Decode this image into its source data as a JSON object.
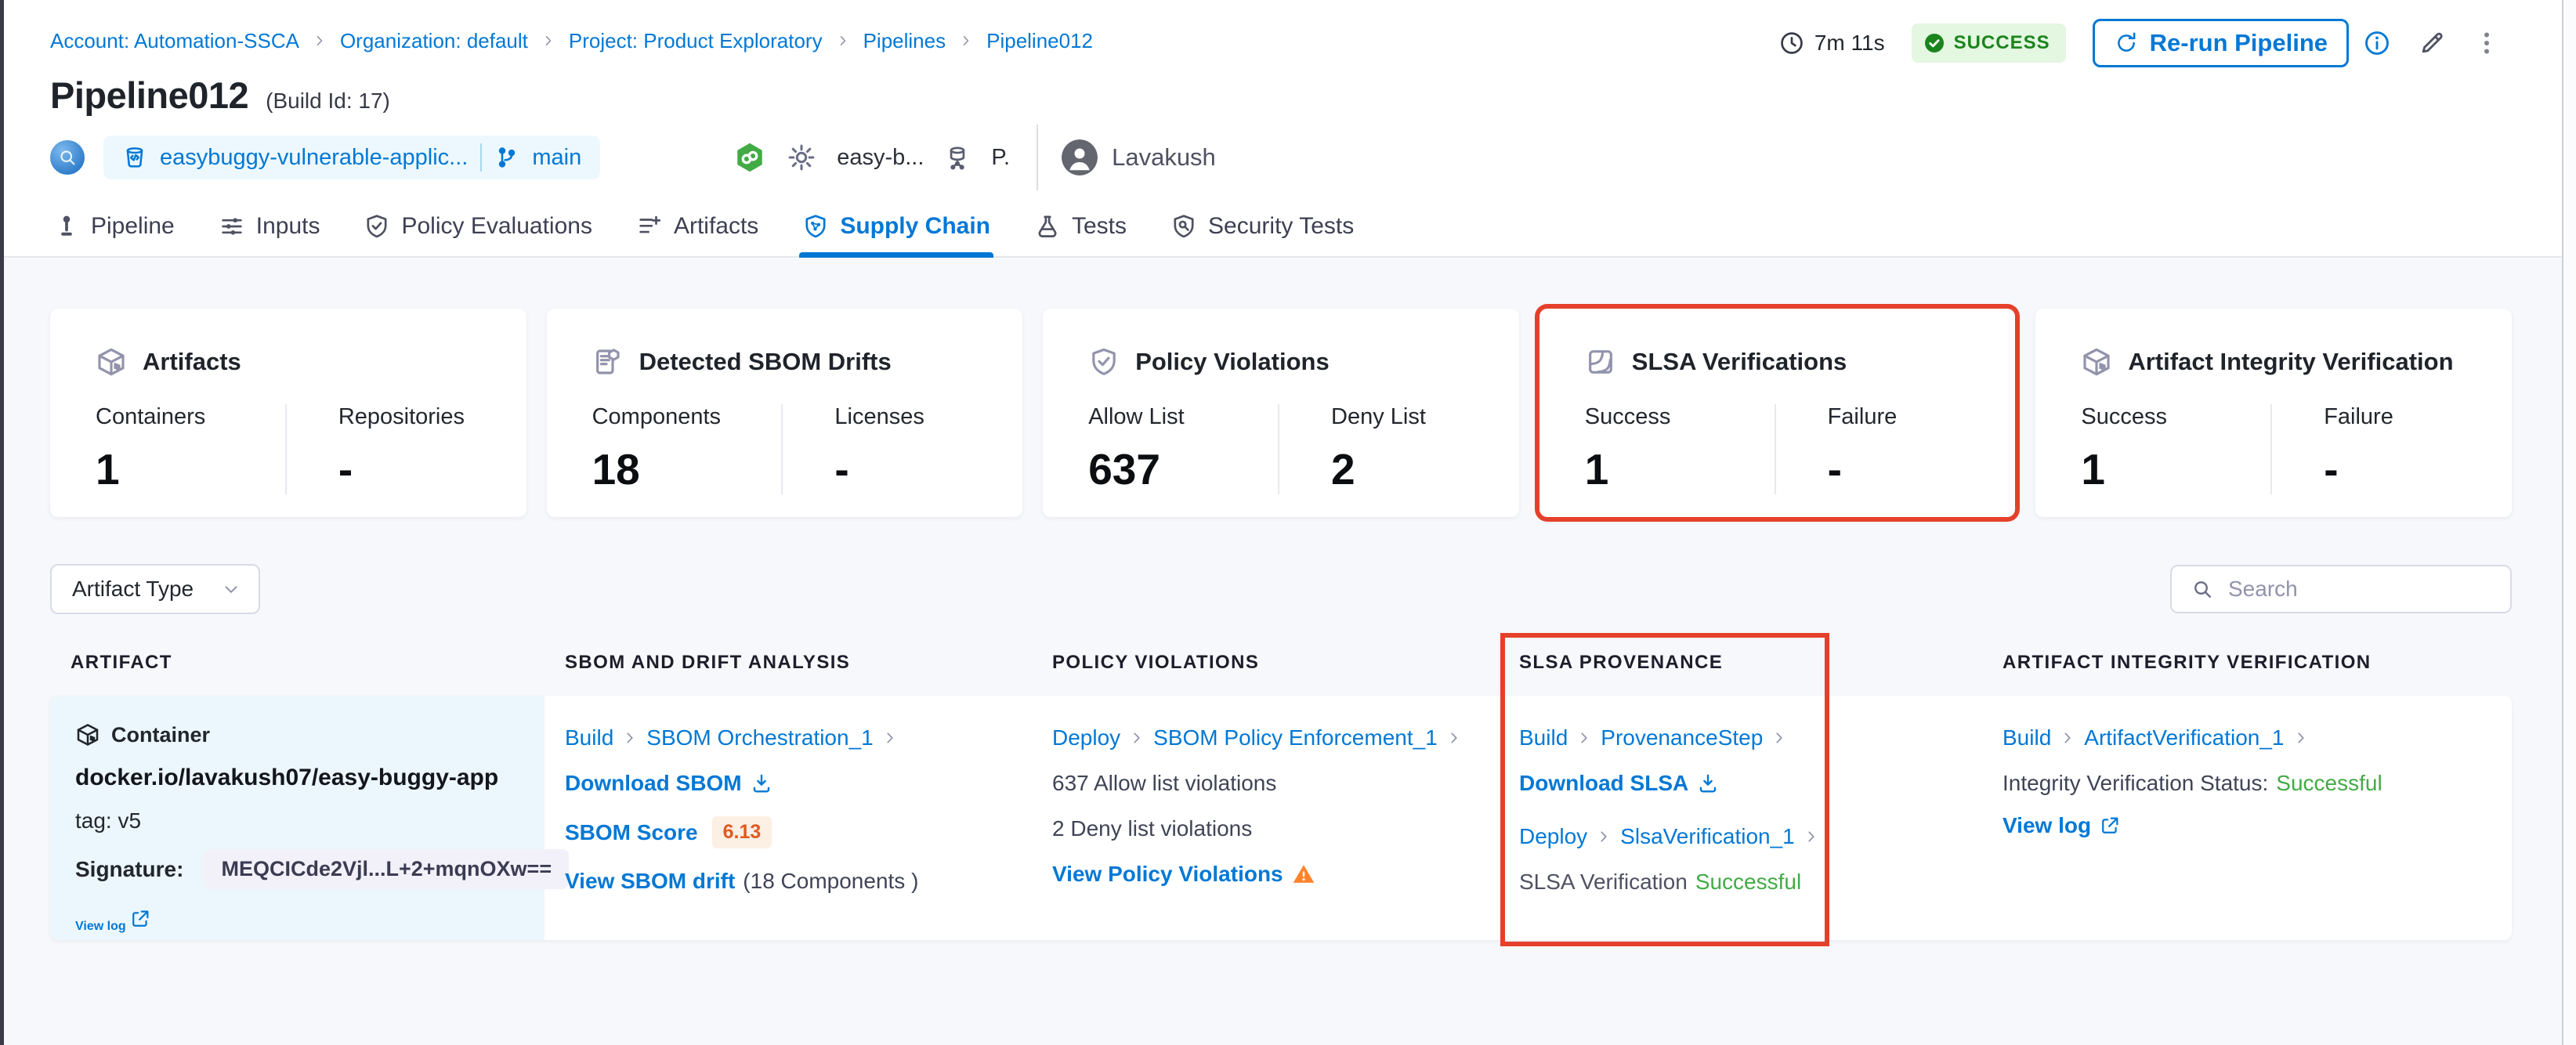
{
  "colors": {
    "primary_blue": "#0278d5",
    "success_green": "#1b841d",
    "success_text_green": "#42ab45",
    "annotation_red": "#e5402a",
    "warning_orange": "#ff832b",
    "score_orange": "#e05a1f",
    "page_background": "#f7f8fb"
  },
  "breadcrumb": {
    "items": [
      "Account: Automation-SSCA",
      "Organization: default",
      "Project: Product Exploratory",
      "Pipelines",
      "Pipeline012"
    ]
  },
  "header": {
    "title": "Pipeline012",
    "build_id": "(Build Id: 17)",
    "duration": "7m 11s",
    "status": "SUCCESS",
    "rerun_label": "Re-run Pipeline",
    "repo_name": "easybuggy-vulnerable-applic...",
    "branch": "main",
    "trigger_text": "easy-b...",
    "trigger_initial": "P.",
    "user_name": "Lavakush"
  },
  "tabs": [
    {
      "id": "pipeline",
      "label": "Pipeline",
      "active": false
    },
    {
      "id": "inputs",
      "label": "Inputs",
      "active": false
    },
    {
      "id": "policy-evaluations",
      "label": "Policy Evaluations",
      "active": false
    },
    {
      "id": "artifacts",
      "label": "Artifacts",
      "active": false
    },
    {
      "id": "supply-chain",
      "label": "Supply Chain",
      "active": true
    },
    {
      "id": "tests",
      "label": "Tests",
      "active": false
    },
    {
      "id": "security-tests",
      "label": "Security Tests",
      "active": false
    }
  ],
  "cards": [
    {
      "icon": "cube",
      "title": "Artifacts",
      "highlighted": false,
      "cols": [
        {
          "label": "Containers",
          "value": "1"
        },
        {
          "label": "Repositories",
          "value": "-"
        }
      ]
    },
    {
      "icon": "sbom",
      "title": "Detected SBOM Drifts",
      "highlighted": false,
      "cols": [
        {
          "label": "Components",
          "value": "18"
        },
        {
          "label": "Licenses",
          "value": "-"
        }
      ]
    },
    {
      "icon": "shieldcheck",
      "title": "Policy Violations",
      "highlighted": false,
      "cols": [
        {
          "label": "Allow List",
          "value": "637"
        },
        {
          "label": "Deny List",
          "value": "2"
        }
      ]
    },
    {
      "icon": "slsa",
      "title": "SLSA Verifications",
      "highlighted": true,
      "cols": [
        {
          "label": "Success",
          "value": "1"
        },
        {
          "label": "Failure",
          "value": "-"
        }
      ]
    },
    {
      "icon": "cube",
      "title": "Artifact Integrity Verification",
      "highlighted": false,
      "cols": [
        {
          "label": "Success",
          "value": "1"
        },
        {
          "label": "Failure",
          "value": "-"
        }
      ]
    }
  ],
  "filters": {
    "artifact_type_label": "Artifact Type",
    "search_placeholder": "Search"
  },
  "table": {
    "headers": {
      "artifact": "ARTIFACT",
      "sbom": "SBOM AND DRIFT ANALYSIS",
      "policy": "POLICY VIOLATIONS",
      "slsa": "SLSA PROVENANCE",
      "integrity": "ARTIFACT INTEGRITY VERIFICATION"
    },
    "row": {
      "artifact": {
        "type": "Container",
        "name": "docker.io/lavakush07/easy-buggy-app",
        "tag": "tag: v5",
        "signature_label": "Signature:",
        "signature_value": "MEQCICde2Vjl...L+2+mqnOXw==",
        "view_log": "View log"
      },
      "sbom": {
        "stage": "Build",
        "step": "SBOM Orchestration_1",
        "download": "Download SBOM",
        "score_label": "SBOM Score",
        "score": "6.13",
        "drift_link": "View SBOM drift",
        "drift_suffix": "(18 Components )"
      },
      "policy": {
        "stage": "Deploy",
        "step": "SBOM Policy Enforcement_1",
        "allow": "637 Allow list violations",
        "deny": "2 Deny list violations",
        "view": "View Policy Violations"
      },
      "slsa": {
        "stage1": "Build",
        "step1": "ProvenanceStep",
        "download": "Download SLSA",
        "stage2": "Deploy",
        "step2": "SlsaVerification_1",
        "status_label": "SLSA Verification",
        "status_value": "Successful"
      },
      "integrity": {
        "stage": "Build",
        "step": "ArtifactVerification_1",
        "status_label": "Integrity Verification Status:",
        "status_value": "Successful",
        "view_log": "View log"
      }
    }
  }
}
